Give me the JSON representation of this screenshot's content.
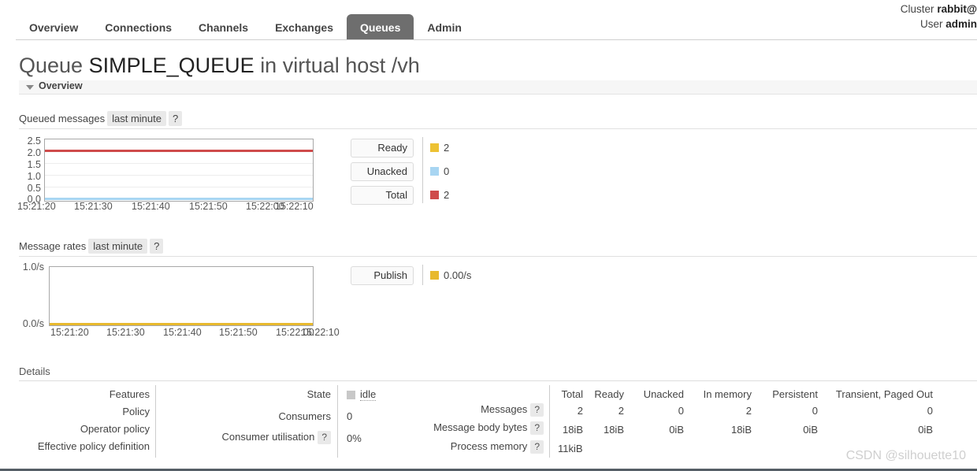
{
  "header": {
    "cluster_label": "Cluster",
    "cluster_name": "rabbit@",
    "user_label": "User",
    "user_name": "admin",
    "tabs": [
      {
        "label": "Overview",
        "active": false
      },
      {
        "label": "Connections",
        "active": false
      },
      {
        "label": "Channels",
        "active": false
      },
      {
        "label": "Exchanges",
        "active": false
      },
      {
        "label": "Queues",
        "active": true
      },
      {
        "label": "Admin",
        "active": false
      }
    ]
  },
  "page": {
    "title_prefix": "Queue",
    "queue_name": "SIMPLE_QUEUE",
    "title_middle": "in virtual host",
    "vhost": "/vh",
    "overview_section": "Overview"
  },
  "queued_messages": {
    "label": "Queued messages",
    "period_button": "last minute",
    "help": "?",
    "legend": [
      {
        "name": "Ready",
        "value": "2",
        "color": "#edc233"
      },
      {
        "name": "Unacked",
        "value": "0",
        "color": "#a8d5f2"
      },
      {
        "name": "Total",
        "value": "2",
        "color": "#cf4b4b"
      }
    ]
  },
  "message_rates": {
    "label": "Message rates",
    "period_button": "last minute",
    "help": "?",
    "legend": [
      {
        "name": "Publish",
        "value": "0.00/s",
        "color": "#e8b92e"
      }
    ]
  },
  "details": {
    "title": "Details",
    "left_labels": [
      "Features",
      "Policy",
      "Operator policy",
      "Effective policy definition"
    ],
    "middle_rows": [
      {
        "label": "State",
        "help": "",
        "value": "idle",
        "is_badge": true
      },
      {
        "label": "Consumers",
        "help": "",
        "value": "0",
        "is_badge": false
      },
      {
        "label": "Consumer utilisation",
        "help": "?",
        "value": "0%",
        "is_badge": false
      }
    ],
    "stats_columns": [
      "Total",
      "Ready",
      "Unacked",
      "In memory",
      "Persistent",
      "Transient, Paged Out"
    ],
    "stats_rows": [
      {
        "label": "Messages",
        "help": "?",
        "values": [
          "2",
          "2",
          "0",
          "2",
          "0",
          "0"
        ]
      },
      {
        "label": "Message body bytes",
        "help": "?",
        "values": [
          "18iB",
          "18iB",
          "0iB",
          "18iB",
          "0iB",
          "0iB"
        ]
      },
      {
        "label": "Process memory",
        "help": "?",
        "values": [
          "11kiB",
          "",
          "",
          "",
          "",
          ""
        ]
      }
    ]
  },
  "watermark": "CSDN @silhouette10",
  "chart_data": [
    {
      "type": "line",
      "title": "Queued messages",
      "xlabel": "",
      "ylabel": "",
      "x": [
        "15:21:20",
        "15:21:30",
        "15:21:40",
        "15:21:50",
        "15:22:00",
        "15:22:10"
      ],
      "yticks": [
        0.0,
        0.5,
        1.0,
        1.5,
        2.0,
        2.5
      ],
      "ylim": [
        0.0,
        2.5
      ],
      "ytick_labels": [
        "0.0",
        "0.5",
        "1.0",
        "1.5",
        "2.0",
        "2.5"
      ],
      "grid": true,
      "legend_position": "right",
      "series": [
        {
          "name": "Ready",
          "color": "#edc233",
          "values": [
            2,
            2,
            2,
            2,
            2,
            2
          ]
        },
        {
          "name": "Unacked",
          "color": "#a8d5f2",
          "values": [
            0,
            0,
            0,
            0,
            0,
            0
          ]
        },
        {
          "name": "Total",
          "color": "#cf4b4b",
          "values": [
            2,
            2,
            2,
            2,
            2,
            2
          ]
        }
      ]
    },
    {
      "type": "line",
      "title": "Message rates",
      "xlabel": "",
      "ylabel": "",
      "x": [
        "15:21:20",
        "15:21:30",
        "15:21:40",
        "15:21:50",
        "15:22:00",
        "15:22:10"
      ],
      "yticks": [
        0.0,
        1.0
      ],
      "ylim": [
        0.0,
        1.0
      ],
      "ytick_labels": [
        "0.0/s",
        "1.0/s"
      ],
      "grid": false,
      "legend_position": "right",
      "series": [
        {
          "name": "Publish",
          "color": "#e8b92e",
          "values": [
            0,
            0,
            0,
            0,
            0,
            0
          ]
        }
      ]
    }
  ]
}
